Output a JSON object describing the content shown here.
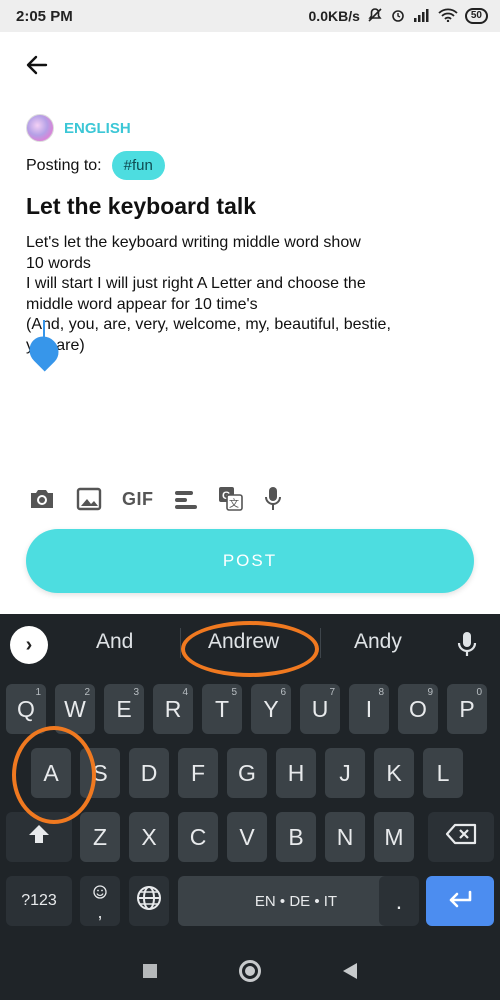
{
  "status_bar": {
    "time": "2:05 PM",
    "net_speed": "0.0KB/s",
    "battery": "50"
  },
  "editor": {
    "language": "ENGLISH",
    "posting_to_label": "Posting to:",
    "tag": "#fun",
    "title": "Let the keyboard talk",
    "body_lines": [
      "Let's let the keyboard writing middle word show",
      "10 words",
      "I will start I will just right A Letter and choose the",
      "middle word appear for 10 time's",
      "(And, you, are, very, welcome, my, beautiful, bestie,",
      "you are)"
    ],
    "toolbar_gif": "GIF",
    "post_button": "POST"
  },
  "keyboard": {
    "suggestions": [
      "And",
      "Andrew",
      "Andy"
    ],
    "row1": [
      {
        "k": "Q",
        "h": "1"
      },
      {
        "k": "W",
        "h": "2"
      },
      {
        "k": "E",
        "h": "3"
      },
      {
        "k": "R",
        "h": "4"
      },
      {
        "k": "T",
        "h": "5"
      },
      {
        "k": "Y",
        "h": "6"
      },
      {
        "k": "U",
        "h": "7"
      },
      {
        "k": "I",
        "h": "8"
      },
      {
        "k": "O",
        "h": "9"
      },
      {
        "k": "P",
        "h": "0"
      }
    ],
    "row2": [
      "A",
      "S",
      "D",
      "F",
      "G",
      "H",
      "J",
      "K",
      "L"
    ],
    "row3": [
      "Z",
      "X",
      "C",
      "V",
      "B",
      "N",
      "M"
    ],
    "symbols_key": "?123",
    "comma_key": ",",
    "space_label": "EN • DE • IT",
    "period_key": "."
  },
  "colors": {
    "accent": "#4ddde0",
    "keyboard_bg": "#1f2428",
    "key_bg": "#3b4247",
    "annotation": "#f07920",
    "enter": "#4c8df0"
  }
}
